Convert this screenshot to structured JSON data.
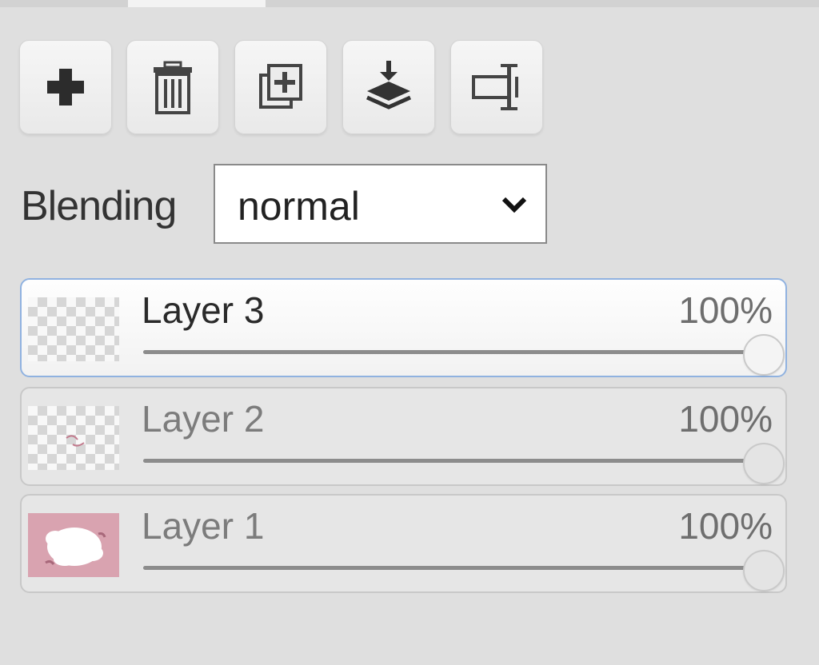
{
  "toolbar": {
    "buttons": [
      {
        "icon": "plus-icon"
      },
      {
        "icon": "trash-icon"
      },
      {
        "icon": "duplicate-icon"
      },
      {
        "icon": "merge-down-icon"
      },
      {
        "icon": "rename-icon"
      }
    ]
  },
  "blending": {
    "label": "Blending",
    "value": "normal"
  },
  "layers": [
    {
      "name": "Layer 3",
      "opacity_text": "100%",
      "opacity": 1.0,
      "active": true
    },
    {
      "name": "Layer 2",
      "opacity_text": "100%",
      "opacity": 1.0,
      "active": false
    },
    {
      "name": "Layer 1",
      "opacity_text": "100%",
      "opacity": 1.0,
      "active": false
    }
  ],
  "colors": {
    "active_border": "#90b2e0",
    "layer1_thumb": "#d9a3b0"
  }
}
